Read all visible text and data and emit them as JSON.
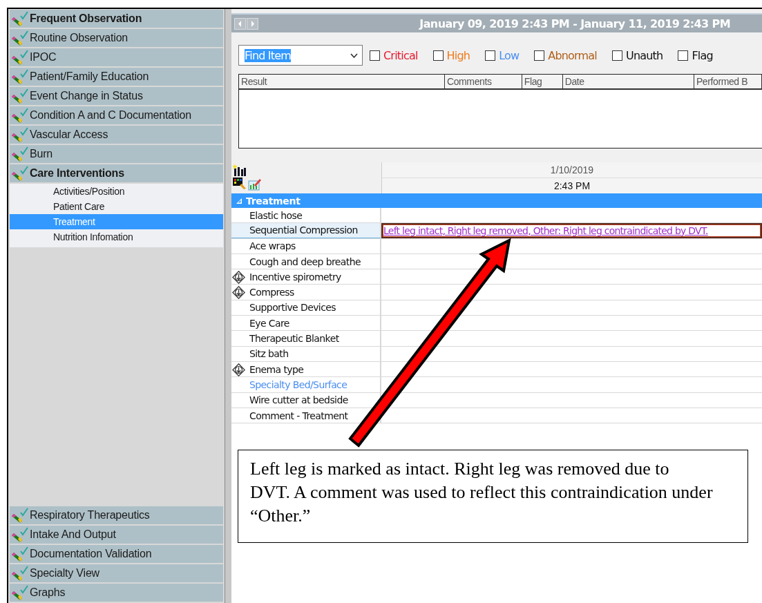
{
  "sidebar": {
    "sections": [
      {
        "label": "Frequent Observation",
        "bold": true
      },
      {
        "label": "Routine Observation",
        "bold": false
      },
      {
        "label": "IPOC",
        "bold": false
      },
      {
        "label": "Patient/Family Education",
        "bold": false
      },
      {
        "label": "Event Change in Status",
        "bold": false
      },
      {
        "label": "Condition A and C Documentation",
        "bold": false
      },
      {
        "label": "Vascular Access",
        "bold": false
      },
      {
        "label": "Burn",
        "bold": false
      },
      {
        "label": "Care Interventions",
        "bold": true,
        "children": [
          {
            "label": "Activities/Position",
            "selected": false
          },
          {
            "label": "Patient Care",
            "selected": false
          },
          {
            "label": "Treatment",
            "selected": true
          },
          {
            "label": "Nutrition Infomation",
            "selected": false
          }
        ]
      },
      {
        "label": "Respiratory Therapeutics",
        "bold": false
      },
      {
        "label": "Intake And Output",
        "bold": false
      },
      {
        "label": "Documentation Validation",
        "bold": false
      },
      {
        "label": "Specialty View",
        "bold": false
      },
      {
        "label": "Graphs",
        "bold": false
      }
    ]
  },
  "date_range": "January 09, 2019 2:43 PM - January 11, 2019 2:43 PM",
  "find_item": {
    "value": "Find Item"
  },
  "filters": [
    {
      "label": "Critical",
      "checked": false,
      "color": "#e8182e"
    },
    {
      "label": "High",
      "checked": false,
      "color": "#f07a1a"
    },
    {
      "label": "Low",
      "checked": false,
      "color": "#4a8ef0"
    },
    {
      "label": "Abnormal",
      "checked": false,
      "color": "#b0601a"
    },
    {
      "label": "Unauth",
      "checked": false,
      "color": "#101010"
    },
    {
      "label": "Flag",
      "checked": false,
      "color": "#101010"
    }
  ],
  "results_table": {
    "columns": [
      "Result",
      "Comments",
      "Flag",
      "Date",
      "Performed B"
    ]
  },
  "flowsheet": {
    "date": "1/10/2019",
    "time": "2:43 PM",
    "group": "Treatment",
    "rows": [
      {
        "label": "Elastic hose",
        "kind": "item",
        "selected": false
      },
      {
        "label": "Sequential Compression",
        "kind": "item",
        "selected": true,
        "value": "Left leg intact, Right leg removed, Other: Right leg contraindicated by DVT."
      },
      {
        "label": "Ace wraps",
        "kind": "item",
        "selected": false
      },
      {
        "label": "Cough and deep breathe",
        "kind": "item",
        "selected": false
      },
      {
        "label": "Incentive spirometry",
        "kind": "multi",
        "selected": false
      },
      {
        "label": "Compress",
        "kind": "multi",
        "selected": false
      },
      {
        "label": "Supportive Devices",
        "kind": "item",
        "selected": false
      },
      {
        "label": "Eye Care",
        "kind": "item",
        "selected": false
      },
      {
        "label": "Therapeutic Blanket",
        "kind": "item",
        "selected": false
      },
      {
        "label": "Sitz bath",
        "kind": "item",
        "selected": false
      },
      {
        "label": "Enema type",
        "kind": "multi",
        "selected": false
      },
      {
        "label": "Specialty Bed/Surface",
        "kind": "link",
        "selected": false
      },
      {
        "label": "Wire cutter at bedside",
        "kind": "item",
        "selected": false
      },
      {
        "label": "Comment - Treatment",
        "kind": "item",
        "selected": false
      }
    ]
  },
  "callout": {
    "text": "Left leg is marked as intact. Right leg was removed due to DVT. A comment was used to reflect this contraindication under “Other.”"
  }
}
